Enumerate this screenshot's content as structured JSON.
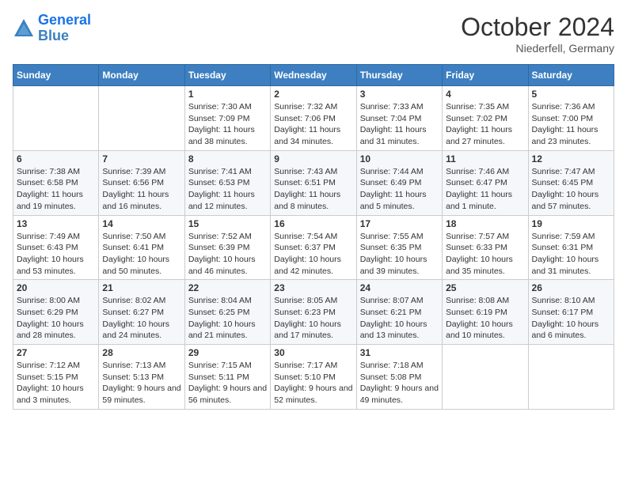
{
  "logo": {
    "line1": "General",
    "line2": "Blue"
  },
  "title": "October 2024",
  "location": "Niederfell, Germany",
  "days_header": [
    "Sunday",
    "Monday",
    "Tuesday",
    "Wednesday",
    "Thursday",
    "Friday",
    "Saturday"
  ],
  "weeks": [
    [
      {
        "num": "",
        "info": ""
      },
      {
        "num": "",
        "info": ""
      },
      {
        "num": "1",
        "info": "Sunrise: 7:30 AM\nSunset: 7:09 PM\nDaylight: 11 hours and 38 minutes."
      },
      {
        "num": "2",
        "info": "Sunrise: 7:32 AM\nSunset: 7:06 PM\nDaylight: 11 hours and 34 minutes."
      },
      {
        "num": "3",
        "info": "Sunrise: 7:33 AM\nSunset: 7:04 PM\nDaylight: 11 hours and 31 minutes."
      },
      {
        "num": "4",
        "info": "Sunrise: 7:35 AM\nSunset: 7:02 PM\nDaylight: 11 hours and 27 minutes."
      },
      {
        "num": "5",
        "info": "Sunrise: 7:36 AM\nSunset: 7:00 PM\nDaylight: 11 hours and 23 minutes."
      }
    ],
    [
      {
        "num": "6",
        "info": "Sunrise: 7:38 AM\nSunset: 6:58 PM\nDaylight: 11 hours and 19 minutes."
      },
      {
        "num": "7",
        "info": "Sunrise: 7:39 AM\nSunset: 6:56 PM\nDaylight: 11 hours and 16 minutes."
      },
      {
        "num": "8",
        "info": "Sunrise: 7:41 AM\nSunset: 6:53 PM\nDaylight: 11 hours and 12 minutes."
      },
      {
        "num": "9",
        "info": "Sunrise: 7:43 AM\nSunset: 6:51 PM\nDaylight: 11 hours and 8 minutes."
      },
      {
        "num": "10",
        "info": "Sunrise: 7:44 AM\nSunset: 6:49 PM\nDaylight: 11 hours and 5 minutes."
      },
      {
        "num": "11",
        "info": "Sunrise: 7:46 AM\nSunset: 6:47 PM\nDaylight: 11 hours and 1 minute."
      },
      {
        "num": "12",
        "info": "Sunrise: 7:47 AM\nSunset: 6:45 PM\nDaylight: 10 hours and 57 minutes."
      }
    ],
    [
      {
        "num": "13",
        "info": "Sunrise: 7:49 AM\nSunset: 6:43 PM\nDaylight: 10 hours and 53 minutes."
      },
      {
        "num": "14",
        "info": "Sunrise: 7:50 AM\nSunset: 6:41 PM\nDaylight: 10 hours and 50 minutes."
      },
      {
        "num": "15",
        "info": "Sunrise: 7:52 AM\nSunset: 6:39 PM\nDaylight: 10 hours and 46 minutes."
      },
      {
        "num": "16",
        "info": "Sunrise: 7:54 AM\nSunset: 6:37 PM\nDaylight: 10 hours and 42 minutes."
      },
      {
        "num": "17",
        "info": "Sunrise: 7:55 AM\nSunset: 6:35 PM\nDaylight: 10 hours and 39 minutes."
      },
      {
        "num": "18",
        "info": "Sunrise: 7:57 AM\nSunset: 6:33 PM\nDaylight: 10 hours and 35 minutes."
      },
      {
        "num": "19",
        "info": "Sunrise: 7:59 AM\nSunset: 6:31 PM\nDaylight: 10 hours and 31 minutes."
      }
    ],
    [
      {
        "num": "20",
        "info": "Sunrise: 8:00 AM\nSunset: 6:29 PM\nDaylight: 10 hours and 28 minutes."
      },
      {
        "num": "21",
        "info": "Sunrise: 8:02 AM\nSunset: 6:27 PM\nDaylight: 10 hours and 24 minutes."
      },
      {
        "num": "22",
        "info": "Sunrise: 8:04 AM\nSunset: 6:25 PM\nDaylight: 10 hours and 21 minutes."
      },
      {
        "num": "23",
        "info": "Sunrise: 8:05 AM\nSunset: 6:23 PM\nDaylight: 10 hours and 17 minutes."
      },
      {
        "num": "24",
        "info": "Sunrise: 8:07 AM\nSunset: 6:21 PM\nDaylight: 10 hours and 13 minutes."
      },
      {
        "num": "25",
        "info": "Sunrise: 8:08 AM\nSunset: 6:19 PM\nDaylight: 10 hours and 10 minutes."
      },
      {
        "num": "26",
        "info": "Sunrise: 8:10 AM\nSunset: 6:17 PM\nDaylight: 10 hours and 6 minutes."
      }
    ],
    [
      {
        "num": "27",
        "info": "Sunrise: 7:12 AM\nSunset: 5:15 PM\nDaylight: 10 hours and 3 minutes."
      },
      {
        "num": "28",
        "info": "Sunrise: 7:13 AM\nSunset: 5:13 PM\nDaylight: 9 hours and 59 minutes."
      },
      {
        "num": "29",
        "info": "Sunrise: 7:15 AM\nSunset: 5:11 PM\nDaylight: 9 hours and 56 minutes."
      },
      {
        "num": "30",
        "info": "Sunrise: 7:17 AM\nSunset: 5:10 PM\nDaylight: 9 hours and 52 minutes."
      },
      {
        "num": "31",
        "info": "Sunrise: 7:18 AM\nSunset: 5:08 PM\nDaylight: 9 hours and 49 minutes."
      },
      {
        "num": "",
        "info": ""
      },
      {
        "num": "",
        "info": ""
      }
    ]
  ]
}
